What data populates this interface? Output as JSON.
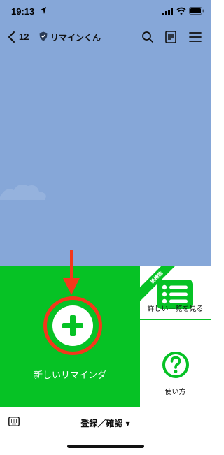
{
  "status_bar": {
    "time": "19:13",
    "icons": [
      "location-arrow-icon",
      "signal-icon",
      "wifi-icon",
      "battery-icon"
    ]
  },
  "header": {
    "back_count": "12",
    "title": "リマインくん",
    "icons": [
      "back-chevron-icon",
      "shield-icon",
      "search-icon",
      "notes-icon",
      "menu-icon"
    ]
  },
  "rich_menu": {
    "new_reminder_label": "新しいリマインダ",
    "detail_badge": "新機能",
    "detail_label": "詳しい一覧を見る",
    "help_label": "使い方",
    "primary_color": "#06c225",
    "highlight_color": "#f4371b"
  },
  "bottom_bar": {
    "toggle_label": "登録／確認 ▾"
  }
}
